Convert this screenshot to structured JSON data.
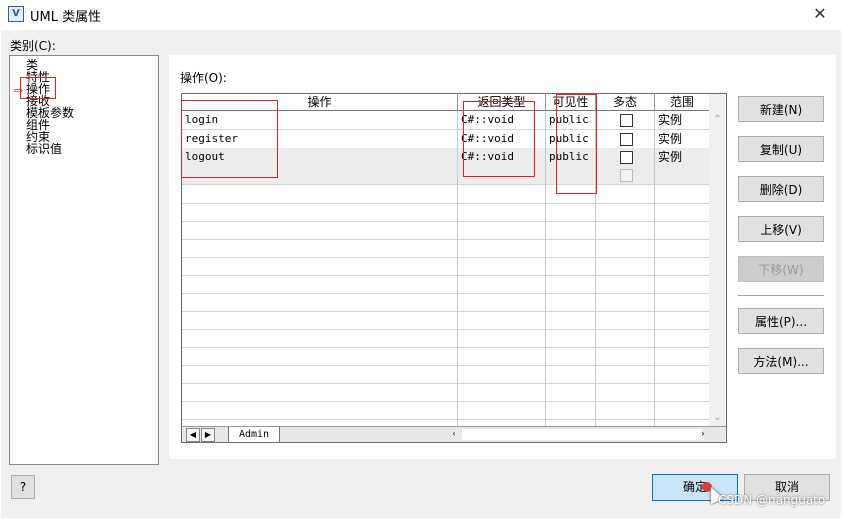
{
  "window": {
    "title": "UML 类属性",
    "app_icon": "V",
    "close_glyph": "✕"
  },
  "categories": {
    "label": "类别(C):",
    "items": [
      "类",
      "特性",
      "操作",
      "接收",
      "模板参数",
      "组件",
      "约束",
      "标识值"
    ],
    "selected": "操作"
  },
  "operations": {
    "label": "操作(O):",
    "columns": [
      "操作",
      "返回类型",
      "可见性",
      "多态",
      "范围"
    ],
    "rows": [
      {
        "name": "login",
        "return_type": "C#::void",
        "visibility": "public",
        "polymorphic": false,
        "scope": "实例"
      },
      {
        "name": "register",
        "return_type": "C#::void",
        "visibility": "public",
        "polymorphic": false,
        "scope": "实例"
      },
      {
        "name": "logout",
        "return_type": "C#::void",
        "visibility": "public",
        "polymorphic": false,
        "scope": "实例"
      }
    ],
    "tab": "Admin"
  },
  "buttons": {
    "new": "新建(N)",
    "duplicate": "复制(U)",
    "delete": "删除(D)",
    "move_up": "上移(V)",
    "move_down": "下移(W)",
    "properties": "属性(P)...",
    "methods": "方法(M)...",
    "help": "?",
    "ok": "确定",
    "cancel": "取消"
  },
  "watermark": "CSDN @nanguato",
  "colors": {
    "annotation_red": "#e02020",
    "ok_border": "#0078d7",
    "ok_fill": "#cce4f7",
    "recording_dot": "#e53935"
  }
}
